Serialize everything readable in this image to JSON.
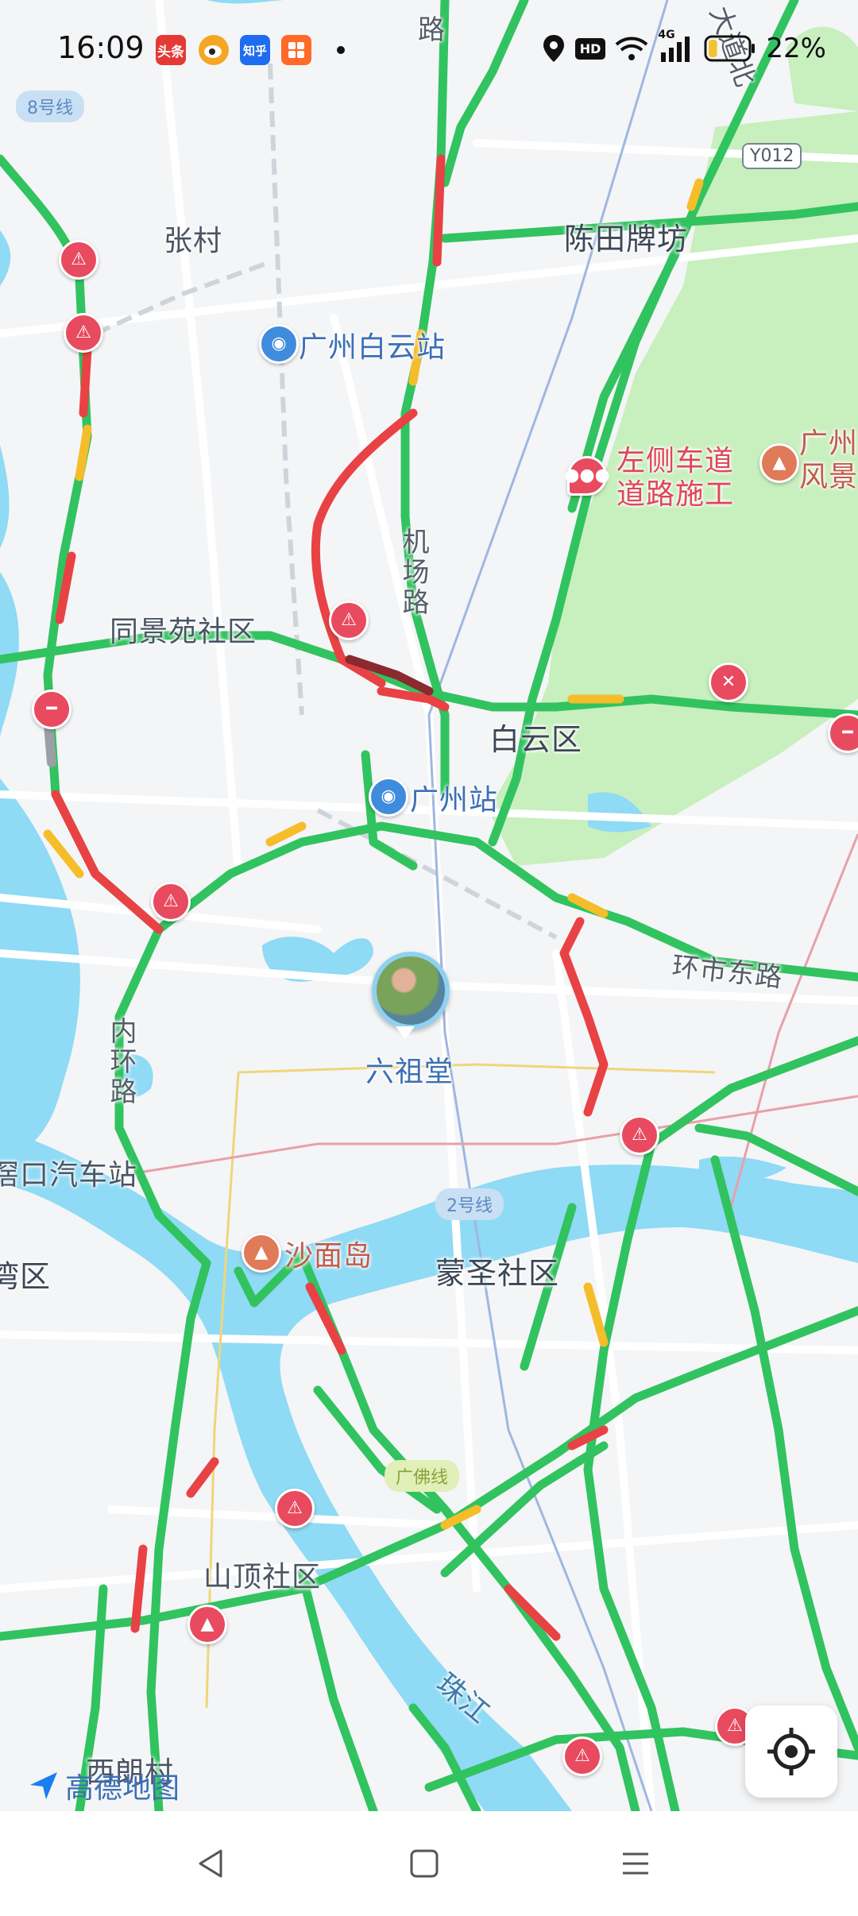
{
  "status_bar": {
    "time": "16:09",
    "apps": [
      {
        "name": "toutiao",
        "label": "头条",
        "color": "#e53935"
      },
      {
        "name": "weibo",
        "label": "",
        "color": "#f5a623"
      },
      {
        "name": "zhihu",
        "label": "知乎",
        "color": "#1e6cf0"
      },
      {
        "name": "extra-app",
        "label": "",
        "color": "#ff6a28"
      }
    ],
    "network": "4G",
    "hd": "HD",
    "battery": "22%",
    "battery_level": 0.22
  },
  "map": {
    "colors": {
      "land": "#f4f5f7",
      "water": "#8fdaf5",
      "park": "#c8efbe",
      "road_clear": "#31c35f",
      "road_slow": "#f5bd2a",
      "road_jam": "#e84245"
    },
    "places": [
      {
        "id": "zhangcun",
        "text": "张村"
      },
      {
        "id": "chentian",
        "text": "陈田牌坊"
      },
      {
        "id": "baiyun-station",
        "text": "广州白云站"
      },
      {
        "id": "tongjingyuan",
        "text": "同景苑社区"
      },
      {
        "id": "baiyun-district",
        "text": "白云区"
      },
      {
        "id": "guangzhou-station",
        "text": "广州站"
      },
      {
        "id": "liuzutang",
        "text": "六祖堂"
      },
      {
        "id": "bus-station",
        "text": "滘口汽车站"
      },
      {
        "id": "shamian",
        "text": "沙面岛"
      },
      {
        "id": "mengsheng",
        "text": "蒙圣社区"
      },
      {
        "id": "district-left",
        "text": "湾区"
      },
      {
        "id": "shanding",
        "text": "山顶社区"
      },
      {
        "id": "xilangcun",
        "text": "西朗村"
      },
      {
        "id": "pearl-river",
        "text": "珠江"
      },
      {
        "id": "scenic",
        "text": "广州\n风景"
      }
    ],
    "roads": {
      "airport_road": "机场路",
      "inner_ring": "内环路",
      "huanshi_east": "环市东路",
      "top_road": "路",
      "top_right_road": "大道北"
    },
    "road_badge": "Y012",
    "metro_lines": [
      "8号线",
      "2号线",
      "广佛线"
    ],
    "incident": "左侧车道\n道路施工"
  },
  "attribution": "高德地图",
  "nav": {
    "back": "back",
    "home": "home",
    "menu": "menu"
  }
}
